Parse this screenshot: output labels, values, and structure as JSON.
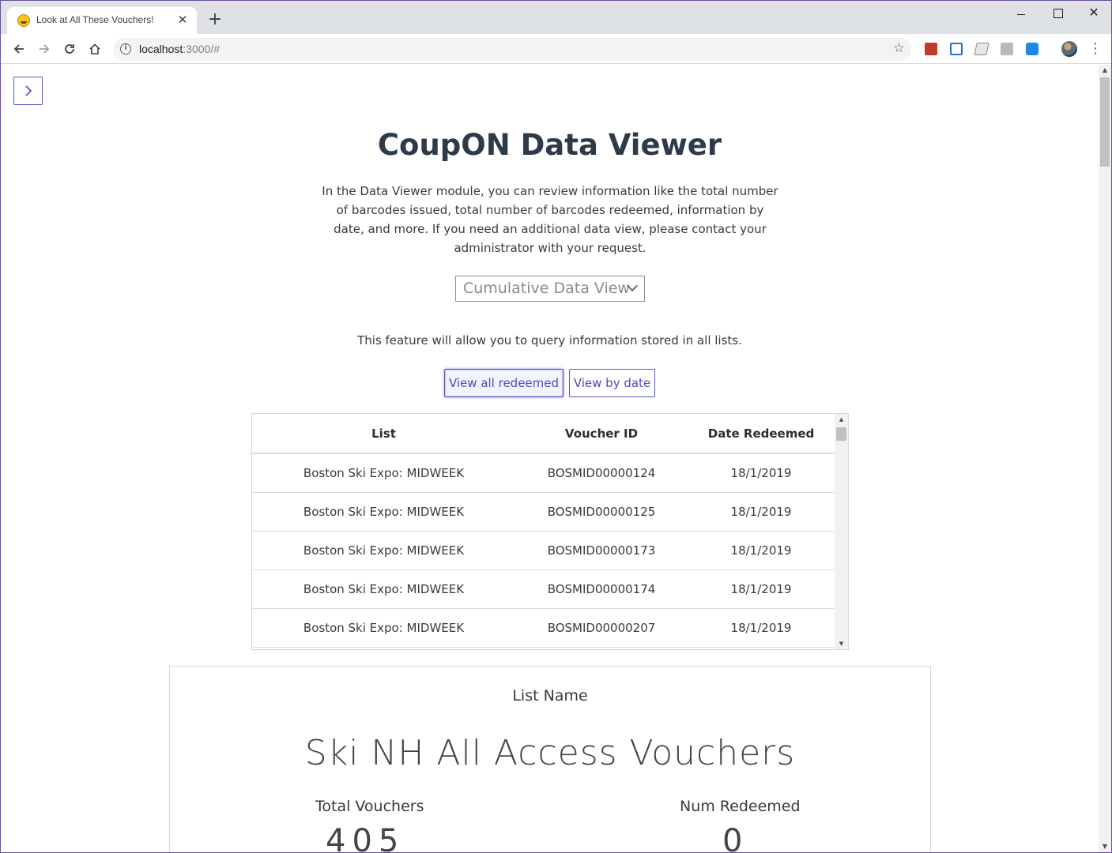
{
  "browser": {
    "tab_title": "Look at All These Vouchers!",
    "url_host": "localhost",
    "url_rest": ":3000/#",
    "close_glyph": "✕",
    "newtab_glyph": "+",
    "icons": [
      "back-icon",
      "forward-icon",
      "reload-icon",
      "home-icon",
      "info-icon",
      "star-icon",
      "more-vert-icon"
    ]
  },
  "page": {
    "title": "CoupON Data Viewer",
    "intro": "In the Data Viewer module, you can review information like the total number of barcodes issued, total number of barcodes redeemed, information by date, and more. If you need an additional data view, please contact your administrator with your request.",
    "view_select": {
      "selected": "Cumulative Data View"
    },
    "feature_text": "This feature will allow you to query information stored in all lists.",
    "buttons": {
      "view_all_redeemed": "View all redeemed",
      "view_by_date": "View by date"
    },
    "accent_color": "#5a55c7"
  },
  "table": {
    "headers": [
      "List",
      "Voucher ID",
      "Date Redeemed"
    ],
    "rows": [
      [
        "Boston Ski Expo: MIDWEEK",
        "BOSMID00000124",
        "18/1/2019"
      ],
      [
        "Boston Ski Expo: MIDWEEK",
        "BOSMID00000125",
        "18/1/2019"
      ],
      [
        "Boston Ski Expo: MIDWEEK",
        "BOSMID00000173",
        "18/1/2019"
      ],
      [
        "Boston Ski Expo: MIDWEEK",
        "BOSMID00000174",
        "18/1/2019"
      ],
      [
        "Boston Ski Expo: MIDWEEK",
        "BOSMID00000207",
        "18/1/2019"
      ]
    ]
  },
  "summary_card": {
    "label": "List Name",
    "list_name": "Ski NH All Access Vouchers",
    "total_vouchers_label": "Total Vouchers",
    "total_vouchers_value": "405",
    "num_redeemed_label": "Num Redeemed",
    "num_redeemed_value": "0"
  }
}
